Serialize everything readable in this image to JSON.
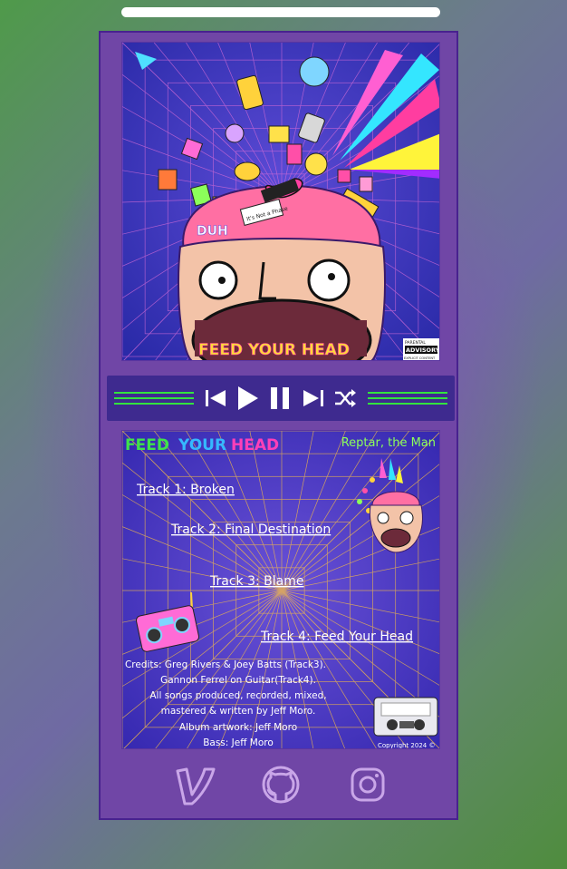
{
  "cover": {
    "title": "FEED YOUR HEAD",
    "cap_text": "DUH",
    "label_text": "It's Not a Phase",
    "advisory_top": "PARENTAL",
    "advisory_main": "ADVISORY",
    "advisory_bottom": "EXPLICIT CONTENT"
  },
  "player": {
    "buttons": [
      "previous",
      "play",
      "pause",
      "next",
      "shuffle"
    ],
    "accent_color": "#33e33f"
  },
  "back_cover": {
    "title_feed": "FEED",
    "title_your": "YOUR",
    "title_head": "HEAD",
    "artist": "Reptar, the Man",
    "tracks": [
      "Track 1: Broken",
      "Track 2: Final Destination",
      "Track 3: Blame",
      "Track 4: Feed Your Head"
    ],
    "credits": [
      "Credits: Greg Rivers & Joey Batts (Track3).",
      "Gannon Ferrel on Guitar(Track4).",
      "All songs produced, recorded, mixed,",
      "mastered & written by Jeff Moro.",
      "Album artwork: Jeff Moro",
      "Bass: Jeff Moro"
    ],
    "copyright": "Copyright 2024 ©"
  },
  "social": {
    "links": [
      "vimeo-icon",
      "github-icon",
      "instagram-icon"
    ]
  }
}
